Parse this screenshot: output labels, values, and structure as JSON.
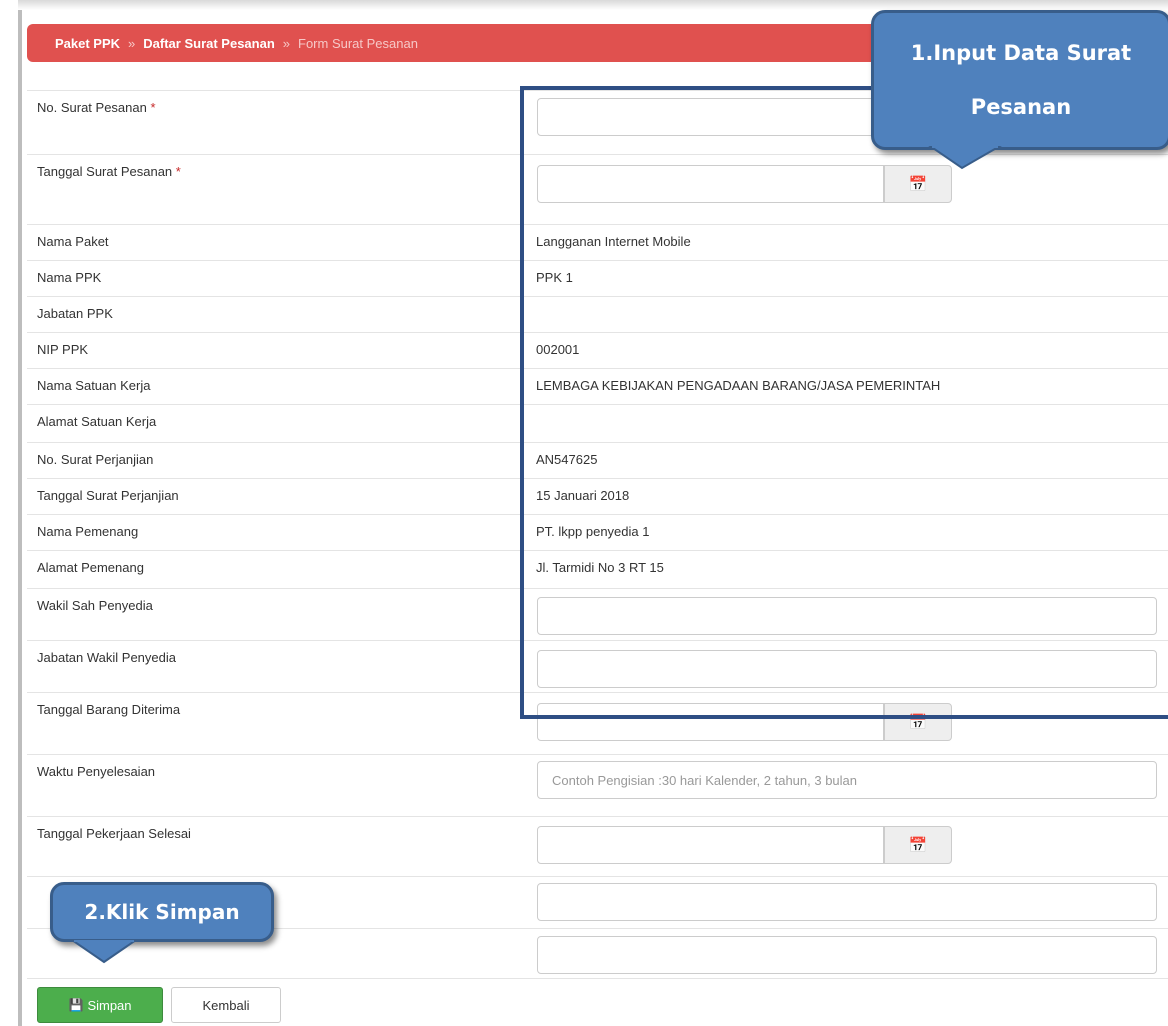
{
  "breadcrumb": {
    "items": [
      "Paket PPK",
      "Daftar Surat Pesanan"
    ],
    "separator": "»",
    "current": "Form Surat Pesanan"
  },
  "required_marker": "*",
  "form": {
    "no_surat_pesanan": {
      "label": "No. Surat Pesanan",
      "value": ""
    },
    "tanggal_surat_pesanan": {
      "label": "Tanggal Surat Pesanan",
      "value": ""
    },
    "nama_paket": {
      "label": "Nama Paket",
      "value": "Langganan Internet Mobile"
    },
    "nama_ppk": {
      "label": "Nama PPK",
      "value": "PPK 1"
    },
    "jabatan_ppk": {
      "label": "Jabatan PPK",
      "value": ""
    },
    "nip_ppk": {
      "label": "NIP PPK",
      "value": "002001"
    },
    "nama_satuan_kerja": {
      "label": "Nama Satuan Kerja",
      "value": "LEMBAGA KEBIJAKAN PENGADAAN BARANG/JASA PEMERINTAH"
    },
    "alamat_satuan_kerja": {
      "label": "Alamat Satuan Kerja",
      "value": ""
    },
    "no_surat_perjanjian": {
      "label": "No. Surat Perjanjian",
      "value": "AN547625"
    },
    "tanggal_surat_perjanjian": {
      "label": "Tanggal Surat Perjanjian",
      "value": "15 Januari 2018"
    },
    "nama_pemenang": {
      "label": "Nama Pemenang",
      "value": "PT. lkpp penyedia 1"
    },
    "alamat_pemenang": {
      "label": "Alamat Pemenang",
      "value": "Jl. Tarmidi No 3 RT 15"
    },
    "wakil_sah_penyedia": {
      "label": "Wakil Sah Penyedia",
      "value": ""
    },
    "jabatan_wakil_penyedia": {
      "label": "Jabatan Wakil Penyedia",
      "value": ""
    },
    "tanggal_barang_diterima": {
      "label": "Tanggal Barang Diterima",
      "value": ""
    },
    "waktu_penyelesaian": {
      "label": "Waktu Penyelesaian",
      "value": "",
      "placeholder": "Contoh Pengisian :30 hari Kalender, 2 tahun, 3 bulan"
    },
    "tanggal_pekerjaan_selesai": {
      "label": "Tanggal Pekerjaan Selesai",
      "value": ""
    },
    "extra_field_1": {
      "value": ""
    },
    "extra_field_2": {
      "value": ""
    }
  },
  "icons": {
    "calendar": "calendar-icon",
    "save": "floppy-disk-icon"
  },
  "buttons": {
    "save": "Simpan",
    "back": "Kembali"
  },
  "callouts": {
    "step1": "1.Input Data Surat Pesanan",
    "step2": "2.Klik Simpan"
  },
  "colors": {
    "breadcrumb_bg": "#e0514f",
    "callout_bg": "#4f81bd",
    "highlight_border": "#2e4e84",
    "save_button": "#4cae4c"
  }
}
